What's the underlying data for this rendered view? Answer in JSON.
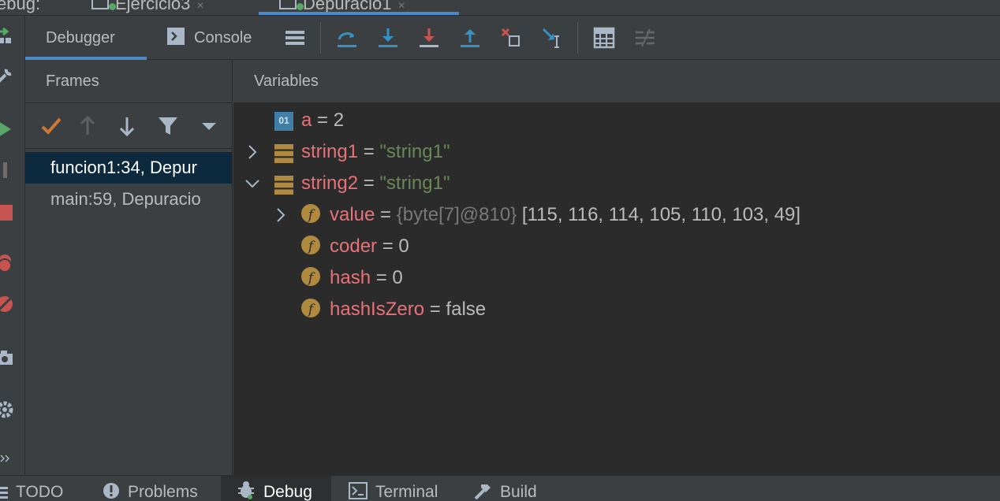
{
  "window": {
    "label": "ebug:",
    "session_tabs": [
      {
        "label": "Ejercicio3",
        "close": "×"
      },
      {
        "label": "Depuracio1",
        "close": "×"
      }
    ]
  },
  "debugger": {
    "tabs": [
      {
        "label": "Debugger",
        "active": true
      },
      {
        "label": "Console",
        "active": false
      }
    ],
    "toolbar_icons": [
      "show-execution-point-icon",
      "step-over-icon",
      "step-into-icon",
      "force-step-into-icon",
      "step-out-icon",
      "drop-frame-icon",
      "run-to-cursor-icon",
      "evaluate-expression-icon",
      "trace-current-stream-icon"
    ]
  },
  "frames": {
    "header": "Frames",
    "items": [
      {
        "label": "funcion1:34, Depur",
        "selected": true
      },
      {
        "label": "main:59, Depuracio",
        "selected": false
      }
    ]
  },
  "variables": {
    "header": "Variables",
    "rows": [
      {
        "icon": "primitive-icon",
        "icon_text": "01",
        "name": "a",
        "op": " = ",
        "value": "2",
        "value_kind": "plain",
        "toggle": ""
      },
      {
        "icon": "object-icon",
        "name": "string1",
        "op": " = ",
        "value": "\"string1\"",
        "value_kind": "string",
        "toggle": "›"
      },
      {
        "icon": "object-icon",
        "name": "string2",
        "op": " = ",
        "value": "\"string1\"",
        "value_kind": "string",
        "toggle": "⌄"
      },
      {
        "icon": "final-field-icon",
        "icon_text": "f",
        "name": "value",
        "op": " = ",
        "meta": "{byte[7]@810} ",
        "value": "[115, 116, 114, 105, 110, 103, 49]",
        "value_kind": "plain",
        "toggle": "›"
      },
      {
        "icon": "final-field-icon",
        "icon_text": "f",
        "name": "coder",
        "op": " = ",
        "value": "0",
        "value_kind": "plain",
        "toggle": ""
      },
      {
        "icon": "field-icon",
        "icon_text": "f",
        "name": "hash",
        "op": " = ",
        "value": "0",
        "value_kind": "plain",
        "toggle": ""
      },
      {
        "icon": "field-icon",
        "icon_text": "f",
        "name": "hashIsZero",
        "op": " = ",
        "value": "false",
        "value_kind": "plain",
        "toggle": ""
      }
    ]
  },
  "bottom_bar": {
    "items": [
      {
        "label": "TODO",
        "active": false
      },
      {
        "label": "Problems",
        "active": false
      },
      {
        "label": "Debug",
        "active": true
      },
      {
        "label": "Terminal",
        "active": false
      },
      {
        "label": "Build",
        "active": false
      }
    ]
  },
  "colors": {
    "accent": "#4a88c7",
    "variable_name": "#e8727a",
    "string_value": "#6a8759",
    "selection": "#0d293e"
  }
}
